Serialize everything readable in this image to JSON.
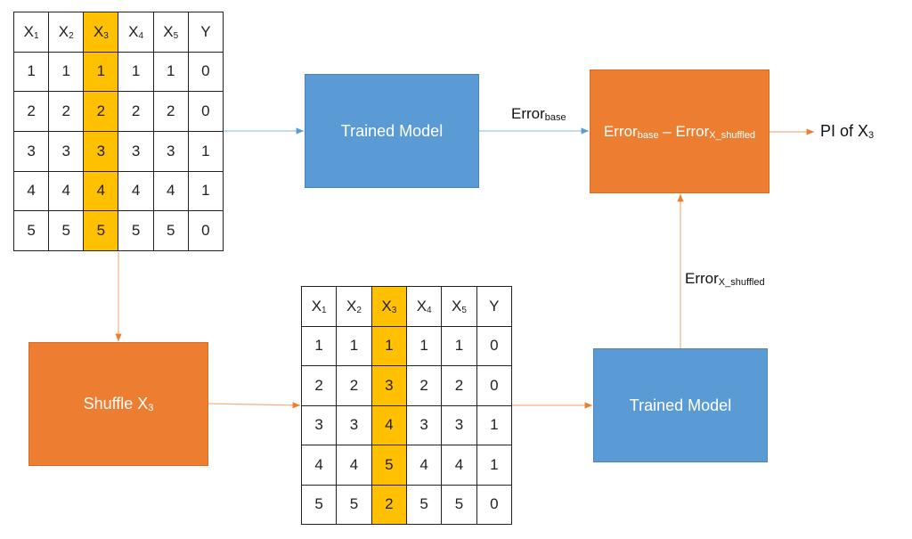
{
  "colors": {
    "highlight": "#FFC000",
    "model_box": "#5B9BD5",
    "process_box": "#ED7D31",
    "blue_arrow": "#9DC3E6",
    "orange_arrow": "#F4B183"
  },
  "original_table": {
    "headers": [
      {
        "base": "X",
        "sub": "1"
      },
      {
        "base": "X",
        "sub": "2"
      },
      {
        "base": "X",
        "sub": "3"
      },
      {
        "base": "X",
        "sub": "4"
      },
      {
        "base": "X",
        "sub": "5"
      },
      {
        "base": "Y",
        "sub": ""
      }
    ],
    "highlighted_column": 2,
    "rows": [
      [
        "1",
        "1",
        "1",
        "1",
        "1",
        "0"
      ],
      [
        "2",
        "2",
        "2",
        "2",
        "2",
        "0"
      ],
      [
        "3",
        "3",
        "3",
        "3",
        "3",
        "1"
      ],
      [
        "4",
        "4",
        "4",
        "4",
        "4",
        "1"
      ],
      [
        "5",
        "5",
        "5",
        "5",
        "5",
        "0"
      ]
    ]
  },
  "shuffled_table": {
    "headers": [
      {
        "base": "X",
        "sub": "1"
      },
      {
        "base": "X",
        "sub": "2"
      },
      {
        "base": "X",
        "sub": "3"
      },
      {
        "base": "X",
        "sub": "4"
      },
      {
        "base": "X",
        "sub": "5"
      },
      {
        "base": "Y",
        "sub": ""
      }
    ],
    "highlighted_column": 2,
    "rows": [
      [
        "1",
        "1",
        "1",
        "1",
        "1",
        "0"
      ],
      [
        "2",
        "2",
        "3",
        "2",
        "2",
        "0"
      ],
      [
        "3",
        "3",
        "4",
        "3",
        "3",
        "1"
      ],
      [
        "4",
        "4",
        "5",
        "4",
        "4",
        "1"
      ],
      [
        "5",
        "5",
        "2",
        "5",
        "5",
        "0"
      ]
    ]
  },
  "boxes": {
    "model_top": {
      "label": "Trained Model"
    },
    "model_bottom": {
      "label": "Trained Model"
    },
    "shuffle": {
      "label": "Shuffle X",
      "sub": "3"
    },
    "difference": {
      "part1": "Error",
      "part1_sub": "base",
      "minus": " – ",
      "part2": "Error",
      "part2_sub": "X_shuffled"
    }
  },
  "labels": {
    "error_base": {
      "text": "Error",
      "sub": "base"
    },
    "error_shuffled": {
      "text": "Error",
      "sub": "X_shuffled"
    },
    "output": {
      "text": "PI of X",
      "sub": "3"
    }
  }
}
